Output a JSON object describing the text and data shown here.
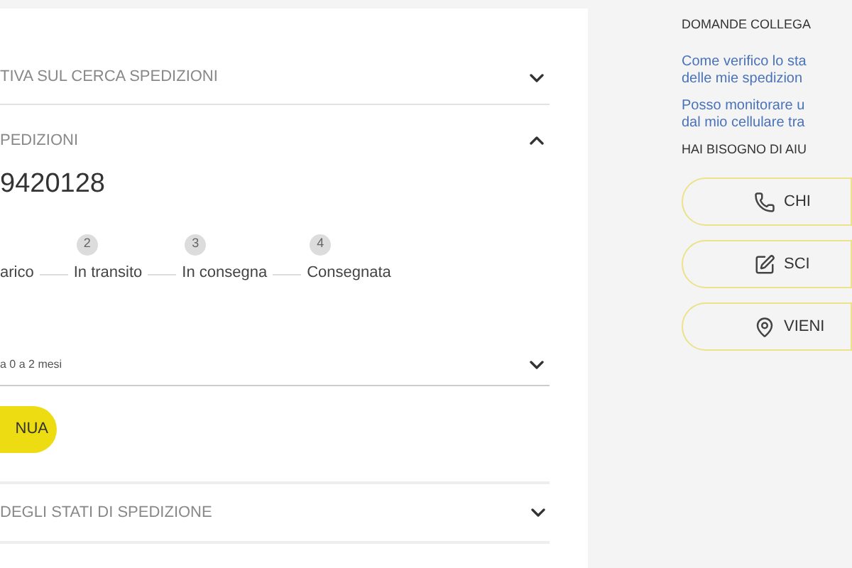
{
  "main": {
    "sections": [
      {
        "title": "TIVA SUL CERCA SPEDIZIONI",
        "expanded": false
      },
      {
        "title": "PEDIZIONI",
        "expanded": true
      }
    ],
    "tracking_number": "9420128",
    "steps": [
      {
        "label": "arico"
      },
      {
        "number": "2",
        "label": "In transito"
      },
      {
        "number": "3",
        "label": "In consegna"
      },
      {
        "number": "4",
        "label": "Consegnata"
      }
    ],
    "period_select": {
      "value": "a 0 a 2 mesi"
    },
    "continue_button": "NUA",
    "footer_section": {
      "title": "DEGLI STATI DI SPEDIZIONE",
      "expanded": false
    }
  },
  "sidebar": {
    "related_title": "DOMANDE COLLEGA",
    "links": [
      {
        "lines": [
          "Come verifico lo sta",
          "delle mie spedizion"
        ]
      },
      {
        "lines": [
          "Posso monitorare u",
          "dal mio cellulare tra"
        ]
      }
    ],
    "help_title": "HAI BISOGNO DI AIU",
    "help_buttons": [
      {
        "kind": "phone",
        "label": "CHI"
      },
      {
        "kind": "write",
        "label": "SCI"
      },
      {
        "kind": "visit",
        "label": "VIENI"
      }
    ]
  }
}
